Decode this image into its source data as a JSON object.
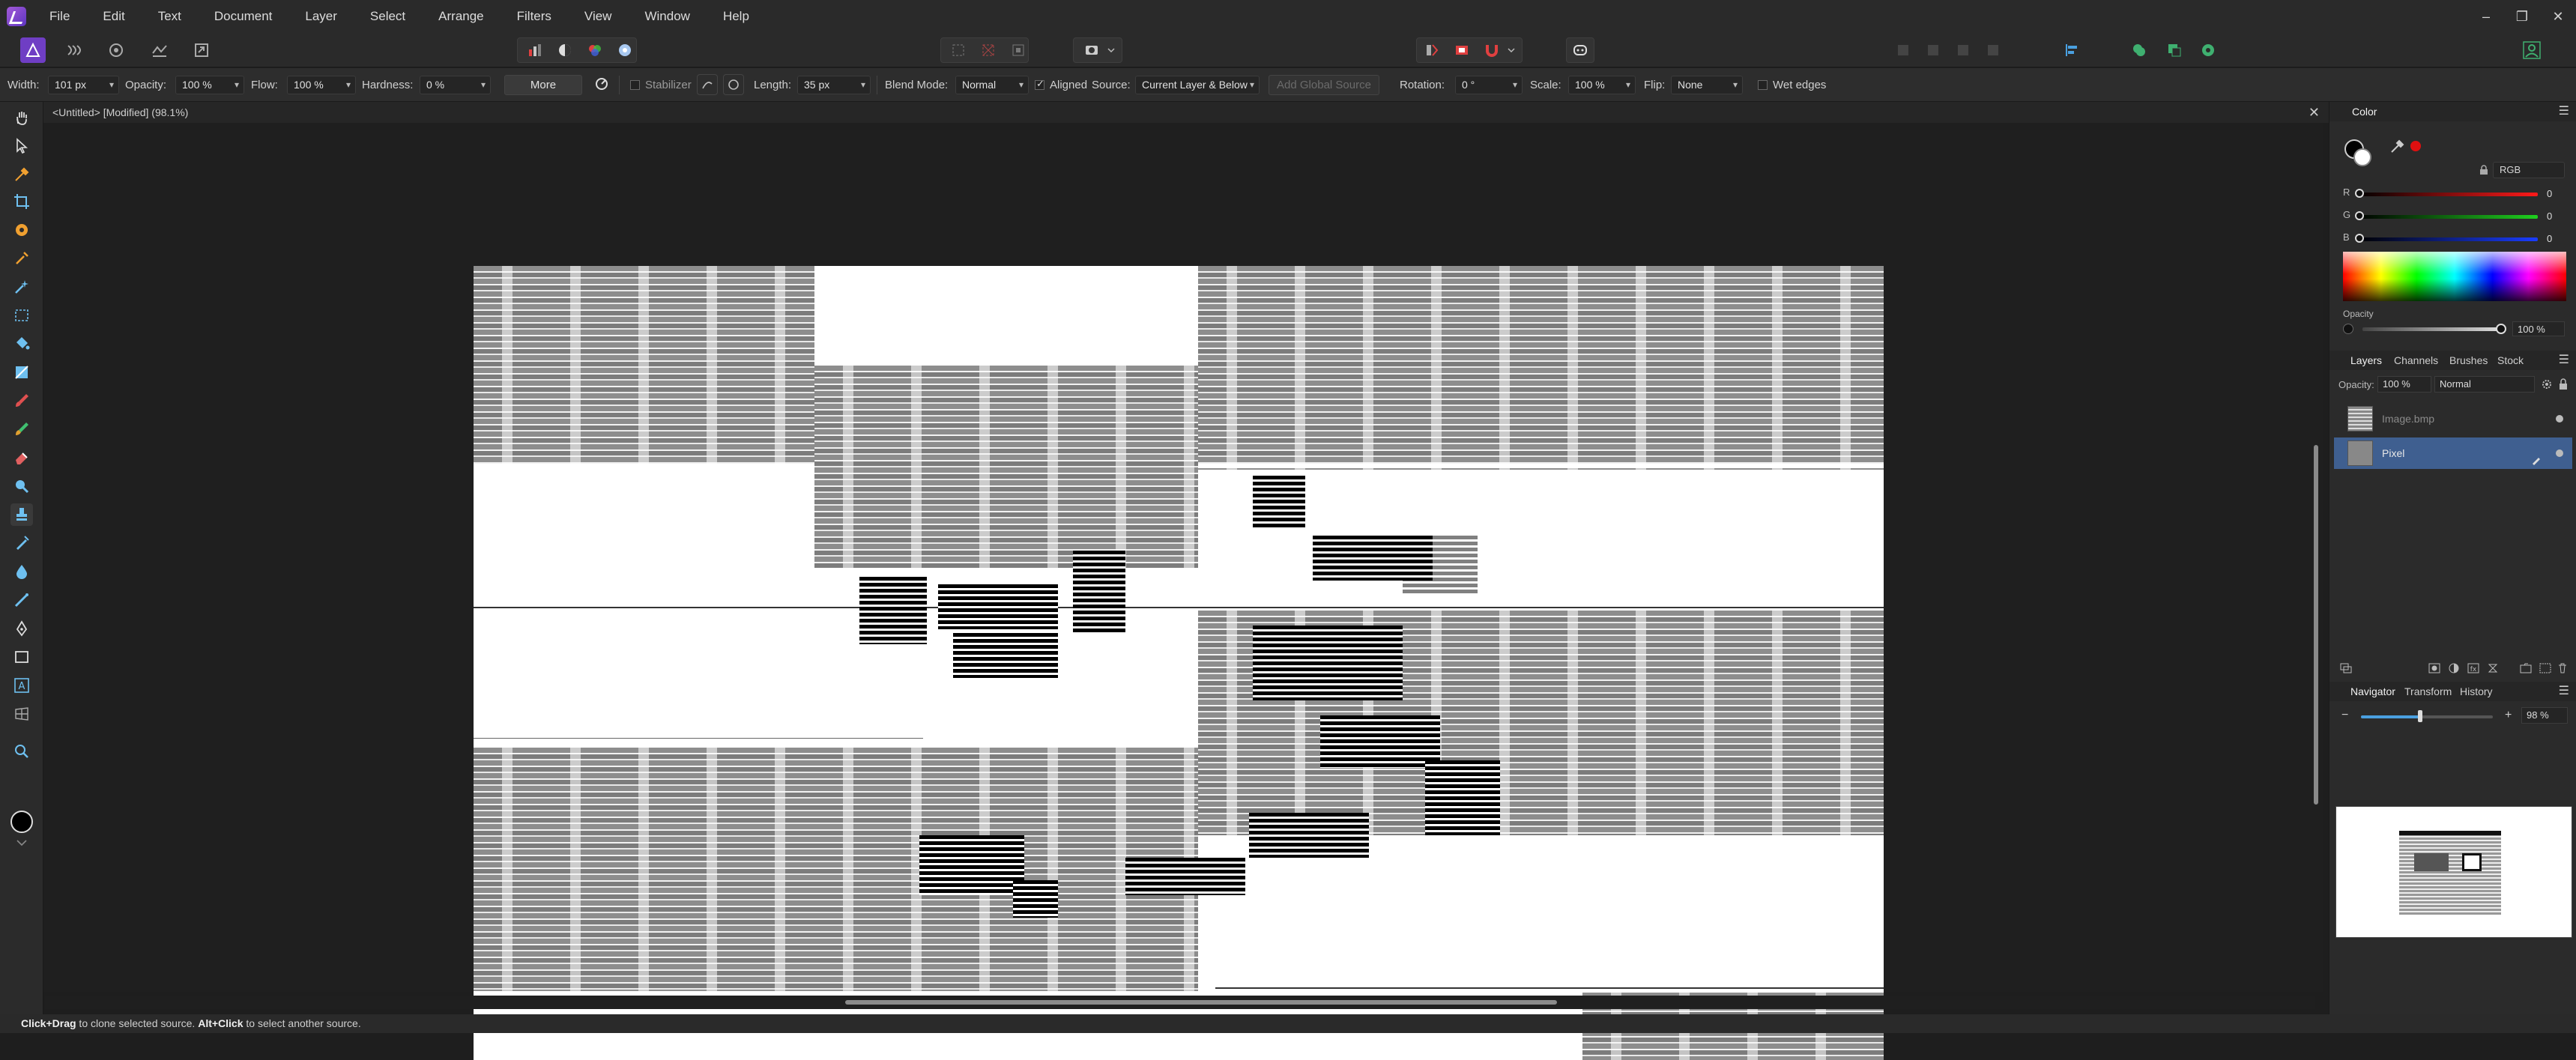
{
  "menu": [
    "File",
    "Edit",
    "Text",
    "Document",
    "Layer",
    "Select",
    "Arrange",
    "Filters",
    "View",
    "Window",
    "Help"
  ],
  "window_controls": {
    "minimize": "–",
    "restore": "❐",
    "close": "✕"
  },
  "context": {
    "width_label": "Width:",
    "width_value": "101 px",
    "opacity_label": "Opacity:",
    "opacity_value": "100 %",
    "flow_label": "Flow:",
    "flow_value": "100 %",
    "hardness_label": "Hardness:",
    "hardness_value": "0 %",
    "more_button": "More",
    "stabilizer_label": "Stabilizer",
    "length_label": "Length:",
    "length_value": "35 px",
    "blend_mode_label": "Blend Mode:",
    "blend_mode_value": "Normal",
    "aligned_label": "Aligned",
    "source_label": "Source:",
    "source_value": "Current Layer & Below",
    "add_global_source": "Add Global Source",
    "rotation_label": "Rotation:",
    "rotation_value": "0 °",
    "scale_label": "Scale:",
    "scale_value": "100 %",
    "flip_label": "Flip:",
    "flip_value": "None",
    "wet_edges_label": "Wet edges"
  },
  "document": {
    "tab_title": "<Untitled> [Modified] (98.1%)",
    "close": "✕"
  },
  "color_panel": {
    "tab": "Color",
    "mode": "RGB",
    "channels": [
      {
        "label": "R",
        "value": "0",
        "color": "#ff1a1a"
      },
      {
        "label": "G",
        "value": "0",
        "color": "#1fd01f"
      },
      {
        "label": "B",
        "value": "0",
        "color": "#1a3dff"
      }
    ],
    "opacity_label": "Opacity",
    "opacity_value": "100 %"
  },
  "layers_panel": {
    "tabs": [
      "Layers",
      "Channels",
      "Brushes",
      "Stock"
    ],
    "opacity_label": "Opacity:",
    "opacity_value": "100 %",
    "blend_value": "Normal",
    "layers": [
      {
        "name": "Image.bmp",
        "selected": false
      },
      {
        "name": "Pixel",
        "selected": true
      }
    ]
  },
  "navigator_panel": {
    "tabs": [
      "Navigator",
      "Transform",
      "History"
    ],
    "zoom_value": "98 %",
    "zoom_level": 0.45
  },
  "status": {
    "part1_bold": "Click+Drag",
    "part1": " to clone selected source. ",
    "part2_bold": "Alt+Click",
    "part2": " to select another source."
  },
  "colors": {
    "accent": "#6f3ec4",
    "selection": "#3f5f90",
    "panel_bg": "#2b2b2b"
  }
}
